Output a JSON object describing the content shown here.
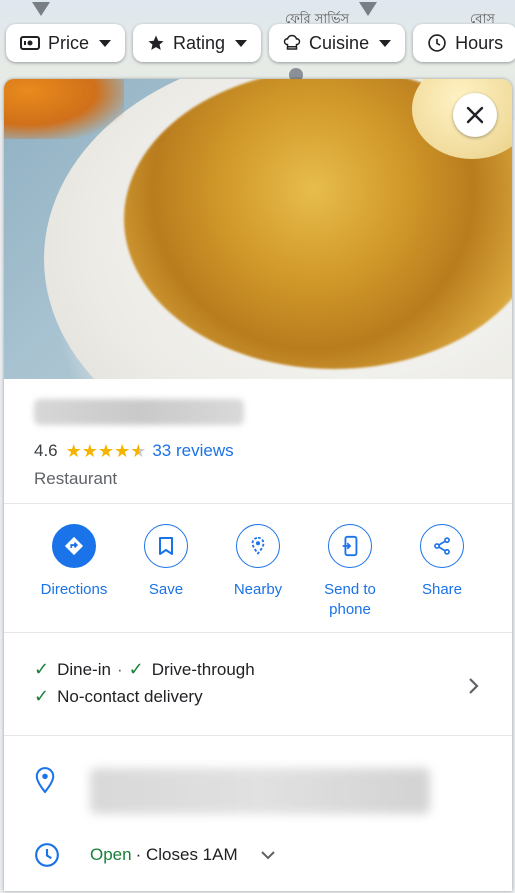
{
  "map": {
    "labels": [
      "ফেরি সার্ভিস",
      "বোস"
    ]
  },
  "filters": [
    {
      "label": "Price",
      "icon": "price-tag-icon",
      "has_caret": true
    },
    {
      "label": "Rating",
      "icon": "star-icon",
      "has_caret": true
    },
    {
      "label": "Cuisine",
      "icon": "chef-hat-icon",
      "has_caret": true
    },
    {
      "label": "Hours",
      "icon": "clock-icon",
      "has_caret": false
    }
  ],
  "place": {
    "rating": "4.6",
    "rating_value": 4.6,
    "reviews": "33 reviews",
    "category": "Restaurant"
  },
  "actions": [
    {
      "label": "Directions",
      "icon": "directions-icon",
      "primary": true
    },
    {
      "label": "Save",
      "icon": "bookmark-icon",
      "primary": false
    },
    {
      "label": "Nearby",
      "icon": "nearby-icon",
      "primary": false
    },
    {
      "label": "Send to phone",
      "icon": "send-to-phone-icon",
      "primary": false
    },
    {
      "label": "Share",
      "icon": "share-icon",
      "primary": false
    }
  ],
  "features": {
    "dine_in": "Dine-in",
    "separator": "·",
    "drive_through": "Drive-through",
    "no_contact": "No-contact delivery"
  },
  "hours": {
    "status": "Open",
    "detail": "· Closes 1AM"
  },
  "colors": {
    "accent": "#1a73e8",
    "star": "#f4b400",
    "open": "#188038"
  }
}
